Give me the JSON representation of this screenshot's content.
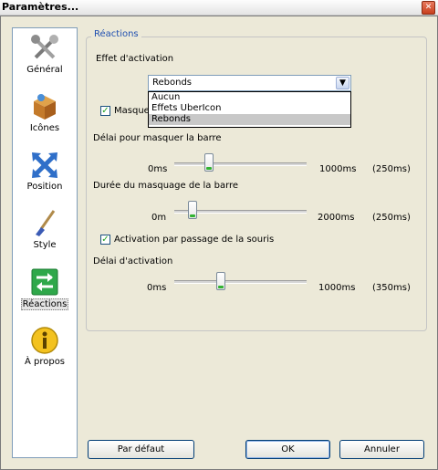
{
  "window": {
    "title": "Paramètres...",
    "close_glyph": "✕"
  },
  "sidebar": {
    "items": [
      {
        "label": "Général",
        "icon": "tools-icon"
      },
      {
        "label": "Icônes",
        "icon": "box-icon"
      },
      {
        "label": "Position",
        "icon": "move-arrows-icon"
      },
      {
        "label": "Style",
        "icon": "brush-icon"
      },
      {
        "label": "Réactions",
        "icon": "swap-arrows-icon",
        "selected": true
      },
      {
        "label": "À propos",
        "icon": "info-icon"
      }
    ]
  },
  "reactions": {
    "group_title": "Réactions",
    "activation_effect_label": "Effet d'activation",
    "activation_effect": {
      "selected": "Rebonds",
      "options": [
        "Aucun",
        "Effets UberIcon",
        "Rebonds"
      ]
    },
    "hide_bar_checkbox": {
      "label": "Masquer",
      "checked": true
    },
    "hide_delay": {
      "label": "Délai pour masquer la barre",
      "min": "0ms",
      "max": "1000ms",
      "current": "(250ms)",
      "value": 250,
      "range": [
        0,
        1000
      ]
    },
    "hide_duration": {
      "label": "Durée du masquage de la barre",
      "min": "0m",
      "max": "2000ms",
      "current": "(250ms)",
      "value": 250,
      "range": [
        0,
        2000
      ]
    },
    "hover_activation": {
      "label": "Activation par passage de la souris",
      "checked": true
    },
    "activation_delay": {
      "label": "Délai d'activation",
      "min": "0ms",
      "max": "1000ms",
      "current": "(350ms)",
      "value": 350,
      "range": [
        0,
        1000
      ]
    }
  },
  "buttons": {
    "defaults": "Par défaut",
    "ok": "OK",
    "cancel": "Annuler"
  },
  "check_glyph": "✓",
  "arrow_glyph": "▼"
}
